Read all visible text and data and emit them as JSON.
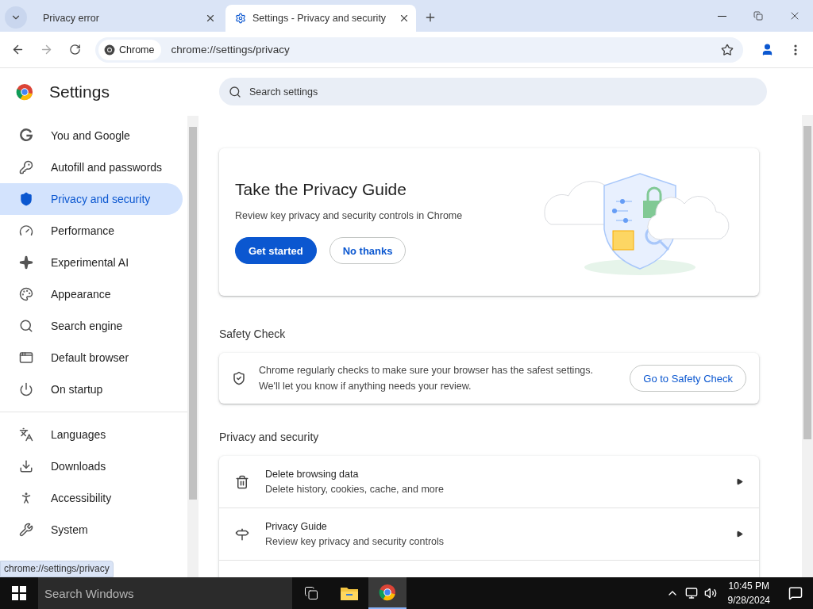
{
  "tabs": [
    {
      "title": "Privacy error",
      "selected": false
    },
    {
      "title": "Settings - Privacy and security",
      "selected": true
    }
  ],
  "omnibox": {
    "chip": "Chrome",
    "url": "chrome://settings/privacy"
  },
  "sidebar": {
    "title": "Settings",
    "groups": [
      {
        "items": [
          {
            "label": "You and Google",
            "selected": false
          },
          {
            "label": "Autofill and passwords",
            "selected": false
          },
          {
            "label": "Privacy and security",
            "selected": true
          },
          {
            "label": "Performance",
            "selected": false
          },
          {
            "label": "Experimental AI",
            "selected": false
          },
          {
            "label": "Appearance",
            "selected": false
          },
          {
            "label": "Search engine",
            "selected": false
          },
          {
            "label": "Default browser",
            "selected": false
          },
          {
            "label": "On startup",
            "selected": false
          }
        ]
      },
      {
        "items": [
          {
            "label": "Languages",
            "selected": false
          },
          {
            "label": "Downloads",
            "selected": false
          },
          {
            "label": "Accessibility",
            "selected": false
          },
          {
            "label": "System",
            "selected": false
          }
        ]
      }
    ]
  },
  "search": {
    "placeholder": "Search settings"
  },
  "privacy_guide_card": {
    "title": "Take the Privacy Guide",
    "description": "Review key privacy and security controls in Chrome",
    "buttons": [
      {
        "label": "Get started",
        "kind": "primary"
      },
      {
        "label": "No thanks",
        "kind": "outline"
      }
    ]
  },
  "safety_check": {
    "heading": "Safety Check",
    "lines": [
      "Chrome regularly checks to make sure your browser has the safest settings.",
      "We'll let you know if anything needs your review."
    ],
    "button": "Go to Safety Check"
  },
  "privacy_section": {
    "heading": "Privacy and security",
    "rows": [
      {
        "title": "Delete browsing data",
        "subtitle": "Delete history, cookies, cache, and more"
      },
      {
        "title": "Privacy Guide",
        "subtitle": "Review key privacy and security controls"
      }
    ]
  },
  "status_bubble": "chrome://settings/privacy",
  "taskbar": {
    "search_placeholder": "Search Windows",
    "time": "10:45 PM",
    "date": "9/28/2024"
  }
}
